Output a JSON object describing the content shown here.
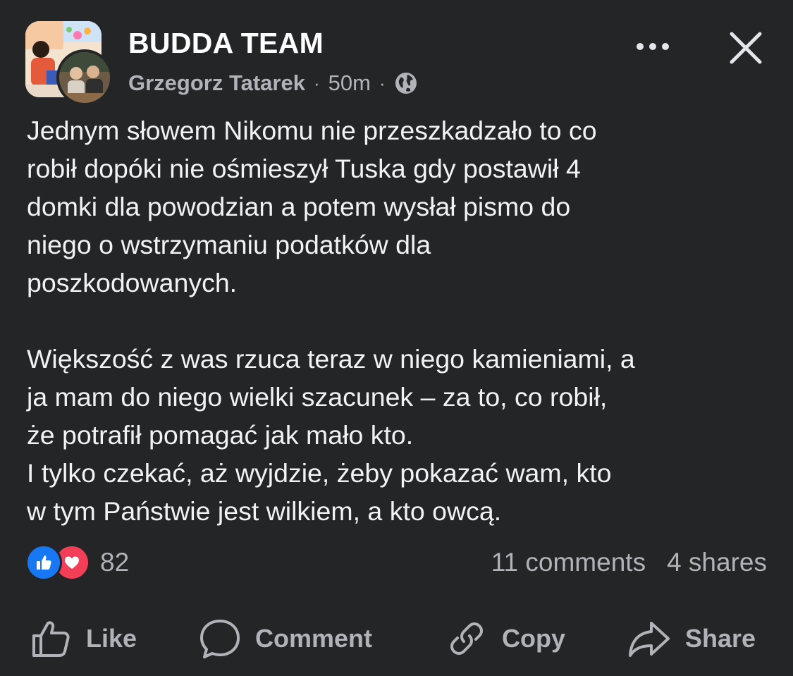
{
  "post": {
    "group_name": "BUDDA TEAM",
    "author": "Grzegorz Tatarek",
    "time": "50m",
    "separator": "·",
    "privacy_icon": "globe-icon",
    "paragraphs": [
      "Jednym słowem Nikomu nie przeszkadzało to co\nrobił dopóki nie ośmieszył Tuska gdy postawił 4\ndomki dla powodzian a potem wysłał pismo do\nniego o wstrzymaniu podatków dla\nposzkodowanych.",
      "Większość z was rzuca teraz w niego kamieniami, a\nja mam do niego wielki szacunek – za to, co robił,\nże potrafił pomagać jak mało kto.\nI tylko czekać, aż wyjdzie, żeby pokazać wam, kto\nw tym Państwie jest wilkiem, a kto owcą."
    ]
  },
  "stats": {
    "reaction_icons": [
      "like-icon",
      "love-icon"
    ],
    "reaction_count": "82",
    "comments": "11 comments",
    "shares": "4 shares"
  },
  "actions": {
    "like": "Like",
    "comment": "Comment",
    "copy": "Copy",
    "share": "Share"
  },
  "colors": {
    "background": "#242526",
    "text_primary": "#FFFFFF",
    "text_secondary": "#B0B3B8",
    "like_blue": "#1877F2",
    "love_red": "#F33E58"
  }
}
